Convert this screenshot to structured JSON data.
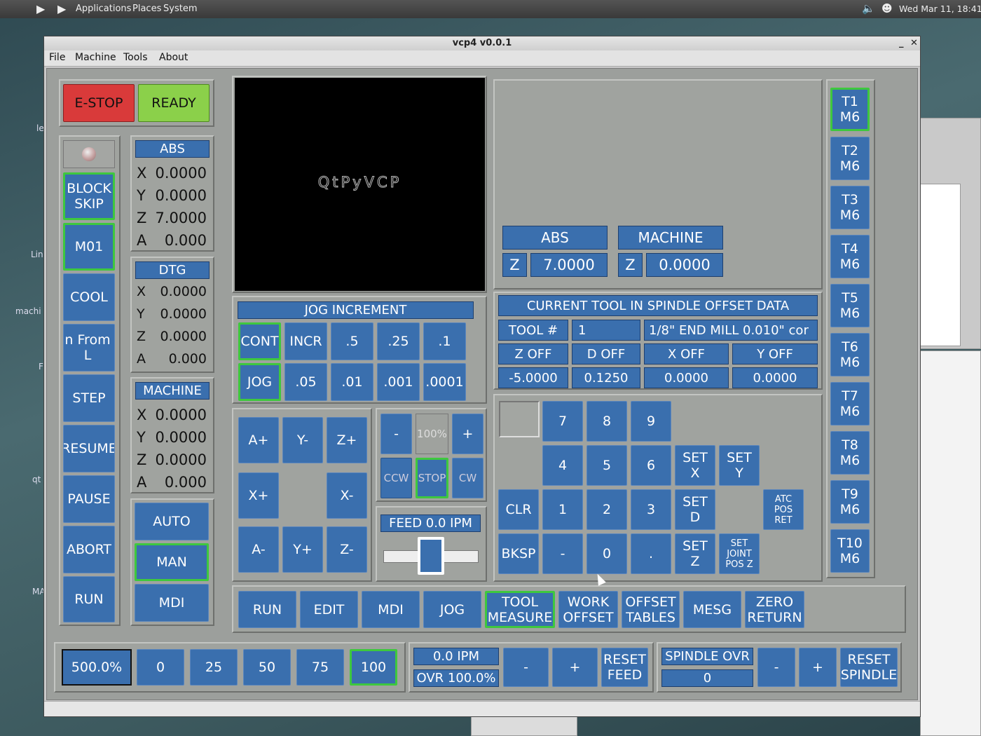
{
  "desktop": {
    "menus": [
      "Applications",
      "Places",
      "System"
    ],
    "clock": "Wed Mar 11, 18:41",
    "icon_labels": [
      "le",
      "Lin",
      "machi",
      "F",
      "qt",
      "MA"
    ]
  },
  "window": {
    "title": "vcp4 v0.0.1",
    "menu": [
      "File",
      "Machine",
      "Tools",
      "About"
    ]
  },
  "estop": {
    "estop": "E-STOP",
    "ready": "READY"
  },
  "left": {
    "block_skip": "BLOCK\nSKIP",
    "m01": "M01",
    "cool": "COOL",
    "from_line": "n From L",
    "step": "STEP",
    "resume": "RESUME",
    "pause": "PAUSE",
    "abort": "ABORT",
    "run": "RUN"
  },
  "abs": {
    "title": "ABS",
    "rows": [
      {
        "axis": "X",
        "value": "0.0000"
      },
      {
        "axis": "Y",
        "value": "0.0000"
      },
      {
        "axis": "Z",
        "value": "7.0000"
      },
      {
        "axis": "A",
        "value": "0.000"
      }
    ]
  },
  "dtg": {
    "title": "DTG",
    "rows": [
      {
        "axis": "X",
        "value": "0.0000"
      },
      {
        "axis": "Y",
        "value": "0.0000"
      },
      {
        "axis": "Z",
        "value": "0.0000"
      },
      {
        "axis": "A",
        "value": "0.000"
      }
    ]
  },
  "machine": {
    "title": "MACHINE",
    "rows": [
      {
        "axis": "X",
        "value": "0.0000"
      },
      {
        "axis": "Y",
        "value": "0.0000"
      },
      {
        "axis": "Z",
        "value": "0.0000"
      },
      {
        "axis": "A",
        "value": " 0.000"
      }
    ]
  },
  "modes": {
    "auto": "AUTO",
    "man": "MAN",
    "mdi": "MDI"
  },
  "preview": {
    "logo": "QtPyVCP"
  },
  "jog_inc": {
    "title": "JOG INCREMENT",
    "row1": [
      "CONT",
      "INCR",
      ".5",
      ".25",
      ".1"
    ],
    "row2": [
      "JOG",
      ".05",
      ".01",
      ".001",
      ".0001"
    ]
  },
  "jog": {
    "a_plus": "A+",
    "y_minus": "Y-",
    "z_plus": "Z+",
    "x_plus": "X+",
    "x_minus": "X-",
    "a_minus": "A-",
    "y_plus": "Y+",
    "z_minus": "Z-"
  },
  "spindle": {
    "minus": "-",
    "pct": "100%",
    "plus": "+",
    "ccw": "CCW",
    "stop": "STOP",
    "cw": "CW"
  },
  "feed": {
    "label": "FEED 0.0  IPM",
    "slider_level": 0.5
  },
  "zdro": {
    "abs_title": "ABS",
    "abs_axis": "Z",
    "abs_value": "7.0000",
    "mach_title": "MACHINE",
    "mach_axis": "Z",
    "mach_value": "0.0000"
  },
  "tool": {
    "title": "CURRENT TOOL IN SPINDLE OFFSET DATA",
    "tool_label": "TOOL #",
    "tool_num": "1",
    "tool_desc": "1/8\" END MILL 0.010\" cor",
    "h": [
      "Z OFF",
      "D OFF",
      "X OFF",
      "Y OFF"
    ],
    "v": [
      "-5.0000",
      "0.1250",
      "0.0000",
      "0.0000"
    ]
  },
  "keypad": {
    "k7": "7",
    "k8": "8",
    "k9": "9",
    "k4": "4",
    "k5": "5",
    "k6": "6",
    "setx": "SET\nX",
    "sety": "SET\nY",
    "clr": "CLR",
    "k1": "1",
    "k2": "2",
    "k3": "3",
    "setd": "SET\nD",
    "atc": "ATC\nPOS\nRET",
    "bksp": "BKSP",
    "minus": "-",
    "k0": "0",
    "dot": ".",
    "setz": "SET\nZ",
    "setjoint": "SET\nJOINT\nPOS Z"
  },
  "tools": [
    "T1\nM6",
    "T2\nM6",
    "T3\nM6",
    "T4\nM6",
    "T5\nM6",
    "T6\nM6",
    "T7\nM6",
    "T8\nM6",
    "T9\nM6",
    "T10\nM6"
  ],
  "tabs": {
    "run": "RUN",
    "edit": "EDIT",
    "mdi": "MDI",
    "jog": "JOG",
    "tool_measure": "TOOL\nMEASURE",
    "work_offset": "WORK\nOFFSET",
    "offset_tables": "OFFSET\nTABLES",
    "mesg": "MESG",
    "zero_return": "ZERO\nRETURN"
  },
  "rapid": {
    "value": "500.0%",
    "opts": [
      "0",
      "25",
      "50",
      "75",
      "100"
    ]
  },
  "feedovr": {
    "ipm": "0.0  IPM",
    "ovr": "OVR 100.0%",
    "minus": "-",
    "plus": "+",
    "reset": "RESET\nFEED"
  },
  "spovr": {
    "title": "SPINDLE OVR",
    "value": "0",
    "minus": "-",
    "plus": "+",
    "reset": "RESET\nSPINDLE"
  },
  "colors": {
    "blue": "#3a6fae",
    "green_border": "#3ec83e",
    "estop_red": "#d93a3a",
    "ready_green": "#8bd04a",
    "panel": "#9c9f9c"
  }
}
